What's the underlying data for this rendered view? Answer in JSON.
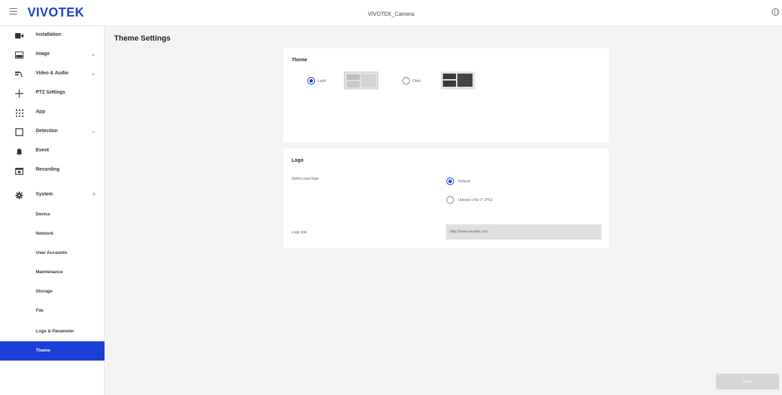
{
  "header": {
    "brand": "VIVOTEK",
    "camera_title": "VIVOTEK_Camera",
    "icons": [
      "hamburger-menu-icon",
      "globe-icon"
    ]
  },
  "sidebar": {
    "items": [
      {
        "label": "Installation",
        "icon": "camera-icon",
        "chevron": ""
      },
      {
        "label": "Image",
        "icon": "image-icon",
        "chevron": "⌄"
      },
      {
        "label": "Video & Audio",
        "icon": "video-audio-icon",
        "chevron": "⌄"
      },
      {
        "label": "PTZ Settings",
        "icon": "ptz-icon",
        "chevron": ""
      },
      {
        "label": "App",
        "icon": "app-grid-icon",
        "chevron": ""
      },
      {
        "label": "Detection",
        "icon": "detection-icon",
        "chevron": "⌄"
      },
      {
        "label": "Event",
        "icon": "bell-icon",
        "chevron": ""
      },
      {
        "label": "Recording",
        "icon": "recording-icon",
        "chevron": ""
      },
      {
        "label": "System",
        "icon": "gear-icon",
        "chevron": "˄"
      }
    ],
    "system_sub_items": [
      {
        "label": "Device"
      },
      {
        "label": "Network"
      },
      {
        "label": "User Accounts"
      },
      {
        "label": "Maintenance"
      },
      {
        "label": "Storage"
      },
      {
        "label": "File"
      },
      {
        "label": "Logs & Parameter"
      },
      {
        "label": "Theme"
      }
    ],
    "active_sub_item": "Theme",
    "active_color": "#1a3fd6"
  },
  "main": {
    "page_title": "Theme Settings",
    "theme_card": {
      "title": "Theme",
      "options": [
        {
          "label": "Light",
          "checked": true
        },
        {
          "label": "Dark",
          "checked": false
        }
      ]
    },
    "logo_card": {
      "title": "Logo",
      "select_label": "Select your logo",
      "options": [
        {
          "label": "Default",
          "checked": true
        },
        {
          "label": "Upload a file (*.JPG)",
          "checked": false
        }
      ],
      "logo_link_label": "Logo link",
      "logo_link_value": "http://www.vivotek.com"
    },
    "save_label": "Save"
  }
}
